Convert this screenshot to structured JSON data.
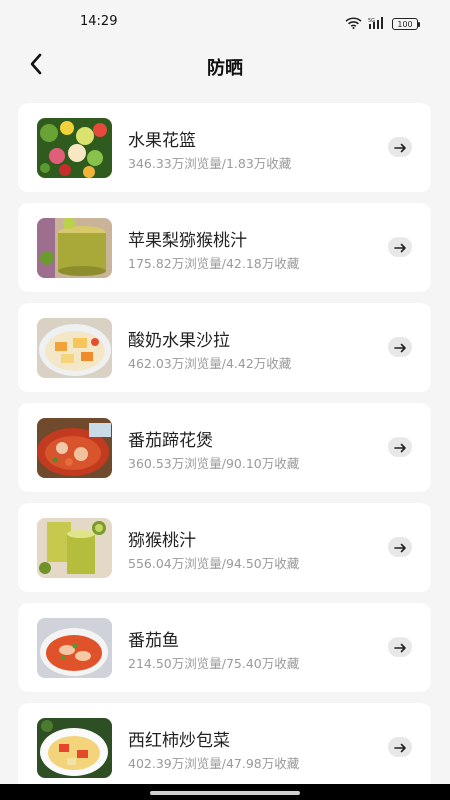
{
  "status": {
    "time": "14:29",
    "battery": "100",
    "wifi_icon": "wifi-icon",
    "signal_icon": "signal-icon"
  },
  "header": {
    "title": "防晒",
    "back_icon": "chevron-left-icon"
  },
  "items": [
    {
      "title": "水果花篮",
      "meta": "346.33万浏览量/1.83万收藏",
      "image": "fruit-salad"
    },
    {
      "title": "苹果梨猕猴桃汁",
      "meta": "175.82万浏览量/42.18万收藏",
      "image": "green-juice"
    },
    {
      "title": "酸奶水果沙拉",
      "meta": "462.03万浏览量/4.42万收藏",
      "image": "yogurt-salad"
    },
    {
      "title": "番茄蹄花煲",
      "meta": "360.53万浏览量/90.10万收藏",
      "image": "tomato-stew"
    },
    {
      "title": "猕猴桃汁",
      "meta": "556.04万浏览量/94.50万收藏",
      "image": "kiwi-juice"
    },
    {
      "title": "番茄鱼",
      "meta": "214.50万浏览量/75.40万收藏",
      "image": "tomato-fish"
    },
    {
      "title": "西红柿炒包菜",
      "meta": "402.39万浏览量/47.98万收藏",
      "image": "tomato-cabbage"
    }
  ],
  "colors": {
    "background": "#f5f5f5",
    "card": "#ffffff",
    "title_text": "#222222",
    "meta_text": "#9a9a9a",
    "arrow_bg": "#e8e8e8"
  }
}
